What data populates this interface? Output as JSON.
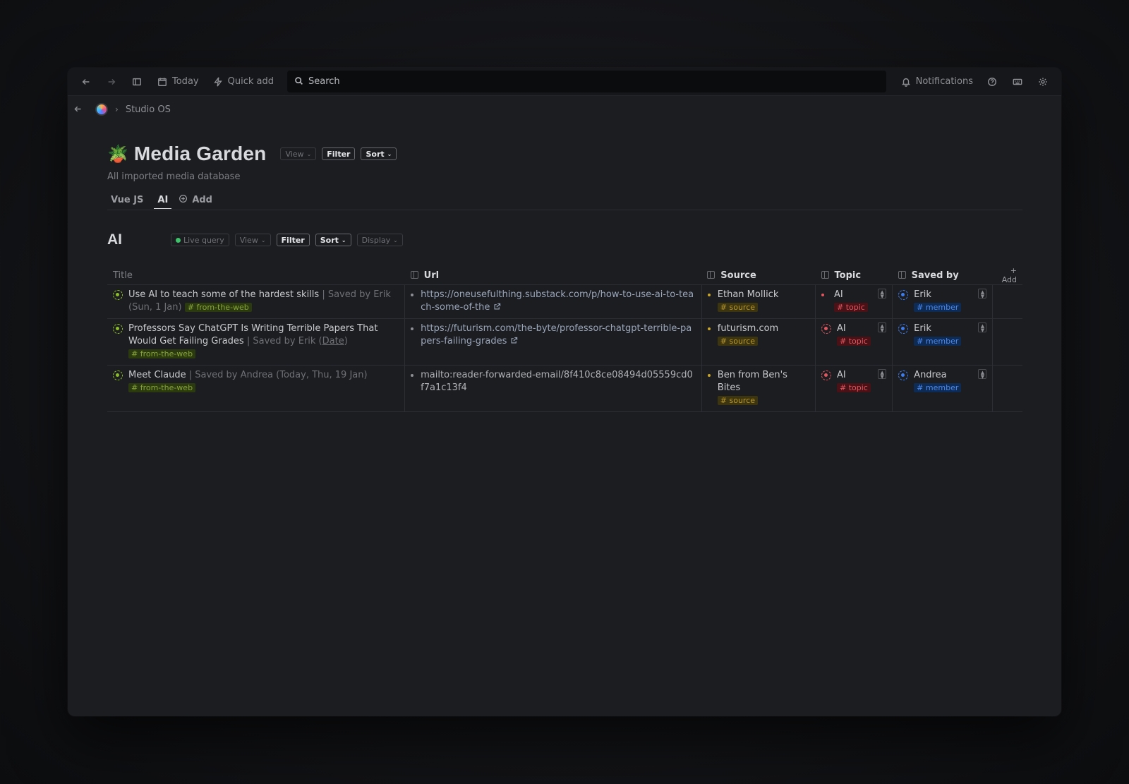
{
  "topbar": {
    "today_label": "Today",
    "quick_add_label": "Quick add",
    "search_placeholder": "Search",
    "notifications_label": "Notifications"
  },
  "breadcrumb": {
    "workspace": "Studio OS"
  },
  "page": {
    "emoji": "🪴",
    "title": "Media Garden",
    "subtitle": "All imported media database",
    "view_label": "View",
    "filter_label": "Filter",
    "sort_label": "Sort"
  },
  "tabs": [
    {
      "label": "Vue JS",
      "active": false
    },
    {
      "label": "AI",
      "active": true
    }
  ],
  "tab_add_label": "Add",
  "section": {
    "title": "AI",
    "live_query_label": "Live query",
    "view_label": "View",
    "filter_label": "Filter",
    "sort_label": "Sort",
    "display_label": "Display"
  },
  "table": {
    "headers": {
      "title": "Title",
      "url": "Url",
      "source": "Source",
      "topic": "Topic",
      "saved_by": "Saved by",
      "add": "+ Add"
    },
    "rows": [
      {
        "title": "Use AI to teach some of the hardest skills",
        "meta": "| Saved by Erik (Sun, 1 Jan)",
        "meta_date": "",
        "meta_end": "",
        "tag": "# from-the-web",
        "url": "https://oneusefulthing.substack.com/p/how-to-use-ai-to-teach-some-of-the",
        "url_is_link": true,
        "source": "Ethan Mollick",
        "source_tag": "# source",
        "topic": "AI",
        "topic_tag": "# topic",
        "saved_by": "Erik",
        "saved_by_tag": "# member"
      },
      {
        "title": "Professors Say ChatGPT Is Writing Terrible Papers That Would Get Failing Grades",
        "meta": "| Saved by Erik (",
        "meta_date": "Date",
        "meta_end": ")",
        "tag": "# from-the-web",
        "url": "https://futurism.com/the-byte/professor-chatgpt-terrible-papers-failing-grades",
        "url_is_link": true,
        "source": "futurism.com",
        "source_tag": "# source",
        "topic": "AI",
        "topic_tag": "# topic",
        "saved_by": "Erik",
        "saved_by_tag": "# member"
      },
      {
        "title": "Meet Claude",
        "meta": "| Saved by Andrea (Today, Thu, 19 Jan)",
        "meta_date": "",
        "meta_end": "",
        "tag": "# from-the-web",
        "url": "mailto:reader-forwarded-email/8f410c8ce08494d05559cd0f7a1c13f4",
        "url_is_link": false,
        "source": "Ben from Ben's Bites",
        "source_tag": "# source",
        "topic": "AI",
        "topic_tag": "# topic",
        "saved_by": "Andrea",
        "saved_by_tag": "# member"
      }
    ]
  }
}
